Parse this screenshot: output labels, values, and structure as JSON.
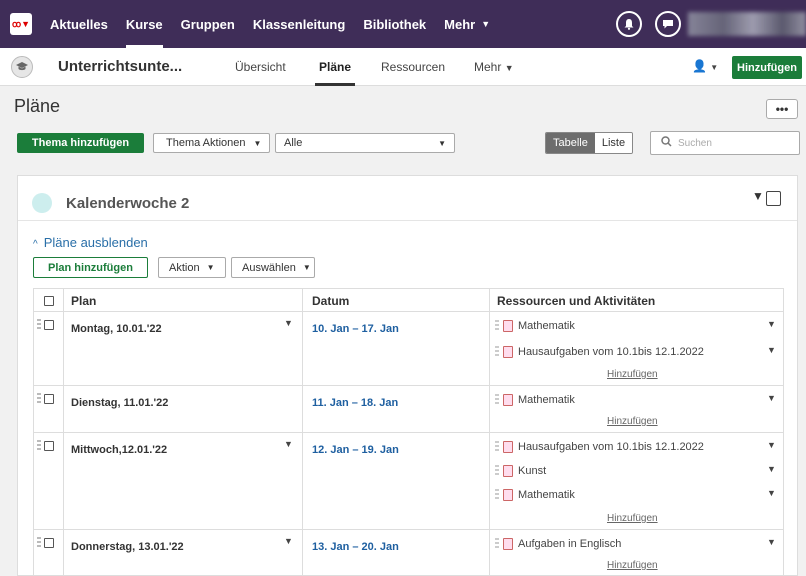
{
  "topnav": {
    "logo_text": "ꝏ▼",
    "items": [
      "Aktuelles",
      "Kurse",
      "Gruppen",
      "Klassenleitung",
      "Bibliothek",
      "Mehr"
    ],
    "active_index": 1,
    "notification_icon": "bell-icon",
    "chat_icon": "chat-bubble-icon"
  },
  "subnav": {
    "course_title": "Unterrichtsunte...",
    "tabs": [
      "Übersicht",
      "Pläne",
      "Ressourcen",
      "Mehr"
    ],
    "active_tab": "Pläne",
    "add_button": "Hinzufügen"
  },
  "page": {
    "title": "Pläne",
    "more_label": "•••"
  },
  "toolbar": {
    "add_topic": "Thema hinzufügen",
    "topic_actions": "Thema Aktionen",
    "filter_value": "Alle",
    "view_table": "Tabelle",
    "view_list": "Liste",
    "search_placeholder": "Suchen"
  },
  "week": {
    "title": "Kalenderwoche 2",
    "hide_plans": "Pläne ausblenden",
    "add_plan": "Plan hinzufügen",
    "action": "Aktion",
    "select": "Auswählen"
  },
  "table": {
    "headers": {
      "plan": "Plan",
      "date": "Datum",
      "resources": "Ressourcen und Aktivitäten"
    },
    "add_link": "Hinzufügen",
    "rows": [
      {
        "plan": "Montag, 10.01.'22",
        "date": "10. Jan – 17. Jan",
        "resources": [
          "Mathematik",
          "Hausaufgaben vom 10.1bis 12.1.2022"
        ]
      },
      {
        "plan": "Dienstag, 11.01.'22",
        "date": "11. Jan – 18. Jan",
        "resources": [
          "Mathematik"
        ]
      },
      {
        "plan": "Mittwoch,12.01.'22",
        "date": "12. Jan – 19. Jan",
        "resources": [
          "Hausaufgaben vom 10.1bis 12.1.2022",
          "Kunst",
          "Mathematik"
        ]
      },
      {
        "plan": "Donnerstag, 13.01.'22",
        "date": "13. Jan – 20. Jan",
        "resources": [
          "Aufgaben in Englisch"
        ]
      }
    ]
  },
  "colors": {
    "topnav": "#3f2d58",
    "primary_green": "#1b7d3a",
    "link_blue": "#1e5fa0"
  }
}
